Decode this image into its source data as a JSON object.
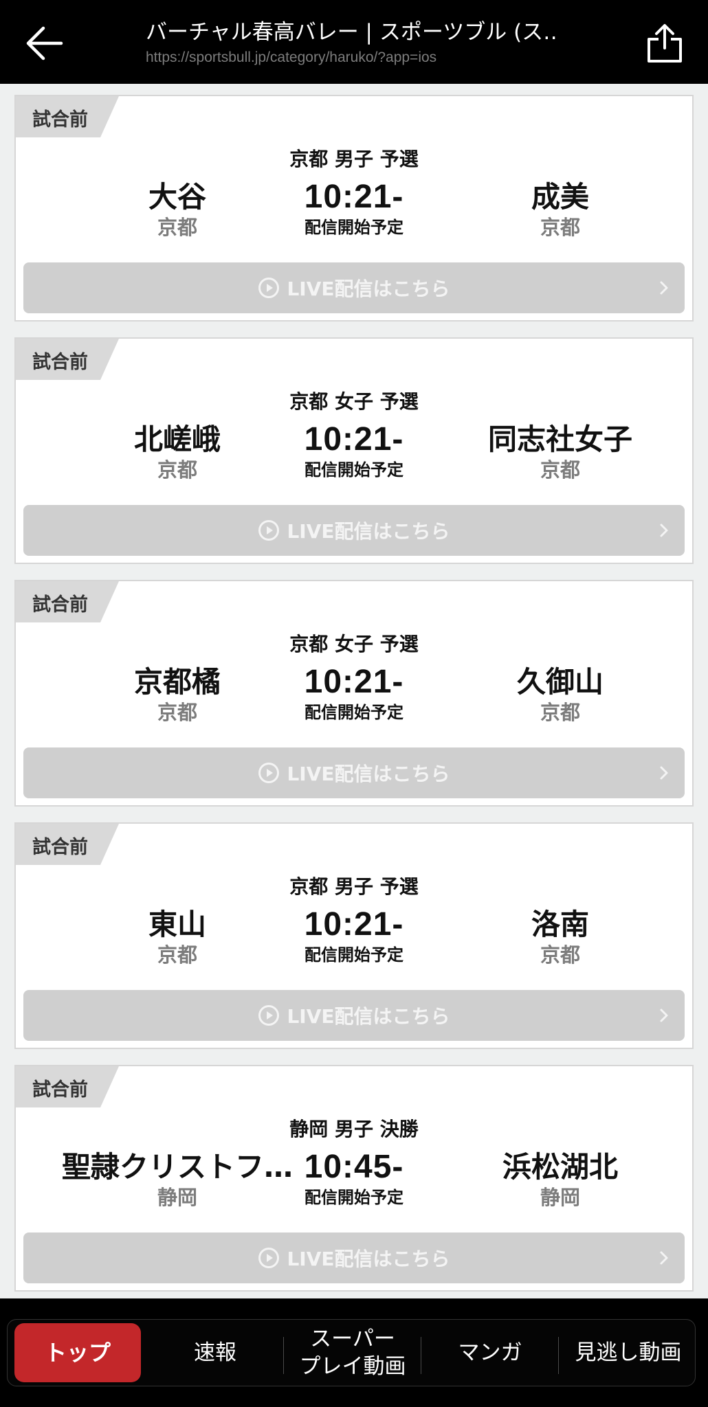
{
  "header": {
    "title": "バーチャル春高バレー | スポーツブル (ス…",
    "url": "https://sportsbull.jp/category/haruko/?app=ios",
    "back_icon": "arrow-left-icon",
    "share_icon": "share-icon"
  },
  "matches": [
    {
      "status": "試合前",
      "category": "京都 男子 予選",
      "home": {
        "name": "大谷",
        "pref": "京都"
      },
      "away": {
        "name": "成美",
        "pref": "京都"
      },
      "time": "10:21-",
      "time_note": "配信開始予定",
      "live_label": "LIVE配信はこちら"
    },
    {
      "status": "試合前",
      "category": "京都 女子 予選",
      "home": {
        "name": "北嵯峨",
        "pref": "京都"
      },
      "away": {
        "name": "同志社女子",
        "pref": "京都"
      },
      "time": "10:21-",
      "time_note": "配信開始予定",
      "live_label": "LIVE配信はこちら"
    },
    {
      "status": "試合前",
      "category": "京都 女子 予選",
      "home": {
        "name": "京都橘",
        "pref": "京都"
      },
      "away": {
        "name": "久御山",
        "pref": "京都"
      },
      "time": "10:21-",
      "time_note": "配信開始予定",
      "live_label": "LIVE配信はこちら"
    },
    {
      "status": "試合前",
      "category": "京都 男子 予選",
      "home": {
        "name": "東山",
        "pref": "京都"
      },
      "away": {
        "name": "洛南",
        "pref": "京都"
      },
      "time": "10:21-",
      "time_note": "配信開始予定",
      "live_label": "LIVE配信はこちら"
    },
    {
      "status": "試合前",
      "category": "静岡 男子 決勝",
      "home": {
        "name": "聖隷クリストフ…",
        "pref": "静岡"
      },
      "away": {
        "name": "浜松湖北",
        "pref": "静岡"
      },
      "time": "10:45-",
      "time_note": "配信開始予定",
      "live_label": "LIVE配信はこちら"
    }
  ],
  "tabs": [
    {
      "label": "トップ",
      "active": true
    },
    {
      "label": "速報",
      "active": false
    },
    {
      "label": "スーパー\nプレイ動画",
      "active": false
    },
    {
      "label": "マンガ",
      "active": false
    },
    {
      "label": "見逃し動画",
      "active": false
    }
  ],
  "colors": {
    "accent": "#c3272a",
    "header_bg": "#000000",
    "live_button": "#cfcfcf",
    "page_bg": "#eef0f0"
  }
}
